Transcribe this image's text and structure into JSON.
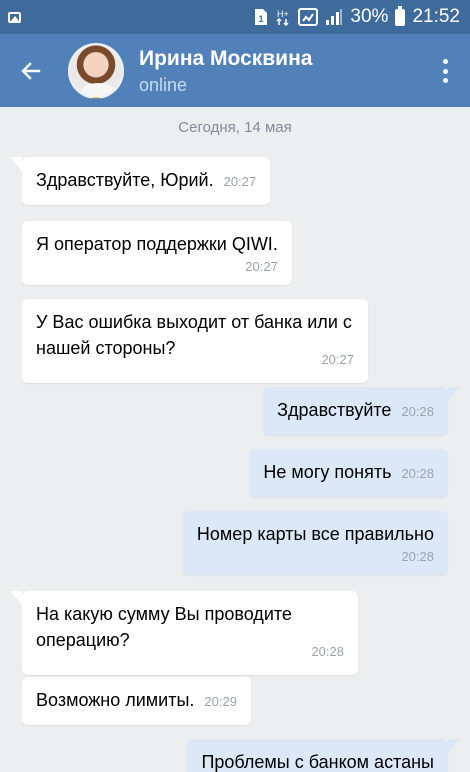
{
  "status_bar": {
    "signal_label": "H+",
    "battery_percent": "30%",
    "time": "21:52"
  },
  "header": {
    "contact_name": "Ирина Москвина",
    "contact_status": "online"
  },
  "chat": {
    "date_separator": "Сегодня, 14 мая",
    "messages": [
      {
        "direction": "in",
        "text": "Здравствуйте, Юрий.",
        "time": "20:27"
      },
      {
        "direction": "in",
        "text": "Я оператор поддержки QIWI.",
        "time": "20:27"
      },
      {
        "direction": "in",
        "text": "У Вас ошибка выходит от банка или с нашей стороны?",
        "time": "20:27"
      },
      {
        "direction": "out",
        "text": "Здравствуйте",
        "time": "20:28"
      },
      {
        "direction": "out",
        "text": "Не могу понять",
        "time": "20:28"
      },
      {
        "direction": "out",
        "text": "Номер карты  все правильно",
        "time": "20:28"
      },
      {
        "direction": "in",
        "text": "На какую сумму Вы проводите операцию?",
        "time": "20:28"
      },
      {
        "direction": "in",
        "text": "Возможно лимиты.",
        "time": "20:29"
      },
      {
        "direction": "out",
        "text": "Проблемы с банком астаны",
        "time": ""
      }
    ]
  },
  "colors": {
    "appbar": "#5181b8",
    "statusbar": "#3f6a9c",
    "incoming_bubble": "#ffffff",
    "outgoing_bubble": "#dce8f7",
    "background": "#edeef0"
  },
  "icons": [
    "gallery-icon",
    "sim-icon",
    "network-icon",
    "signal-icon",
    "battery-icon",
    "back-arrow-icon",
    "more-vertical-icon"
  ]
}
